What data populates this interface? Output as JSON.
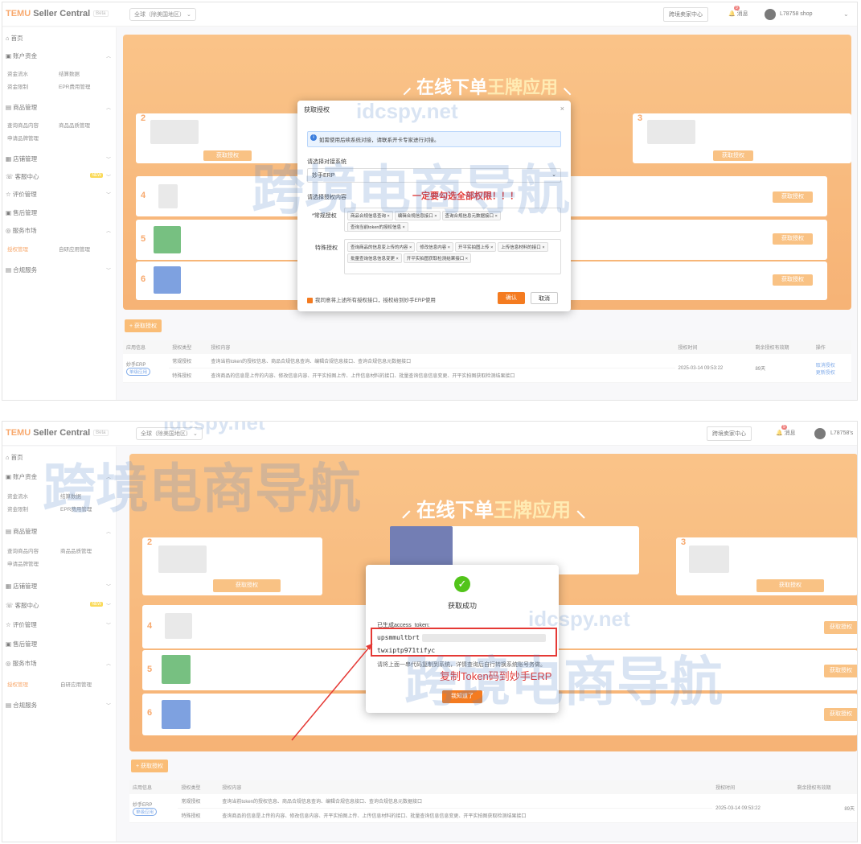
{
  "header": {
    "logo_temu": "TEMU",
    "logo_rest": "Seller Central",
    "beta": "Beta",
    "region": "全球（除美国地区）",
    "hub": "跨境卖家中心",
    "messages": "消息",
    "message_count": "9",
    "shop_1": "L78758 shop",
    "shop_2": "L78758's"
  },
  "sidebar": {
    "home": "首页",
    "account": "账户资金",
    "account_items": [
      "资金流水",
      "结算数据",
      "资金限制",
      "EPR费用管理"
    ],
    "products": "商品管理",
    "products_items": [
      "查询商品内容",
      "商品品质管理",
      "申请品牌管理"
    ],
    "stores": "店铺管理",
    "customer": "客服中心",
    "new_badge": "NEW",
    "reviews": "评价管理",
    "aftersale": "售后管理",
    "market": "服务市场",
    "market_items": [
      "授权管理",
      "自研应用管理"
    ],
    "compliance": "合规服务"
  },
  "banner": {
    "title_a": "在线下单",
    "title_b": "王牌应用",
    "get_button": "获取授权"
  },
  "add_button": "+ 获取授权",
  "table": {
    "headers": [
      "应用信息",
      "授权类型",
      "授权内容",
      "授权时间",
      "剩余授权有效期",
      "操作"
    ],
    "app_name": "妙手ERP",
    "app_badge": "单级应用",
    "rows": [
      {
        "type": "常规授权",
        "content": "查询当前token的授权信息、商品合规信息查询、编辑合规信息接口、查询合规信息元数据接口"
      },
      {
        "type": "特殊授权",
        "content": "查询商品的信息是上传的内容、修改信息内容、开平实拍图上传、上传信息材料的接口、批量查询信息信息变更、开平实拍图获取检测结果接口"
      }
    ],
    "time": "2025-03-14 09:53:22",
    "time_2": "2025-03-14 09:53:22",
    "days": "89天",
    "action_1": "取消授权",
    "action_2": "更新授权"
  },
  "auth_dialog": {
    "title": "获取授权",
    "info": "如需使用后续系统对接，请联系开卡专家进行对接。",
    "select_label": "请选择对接系统",
    "select_value": "妙手ERP",
    "content_label": "请选择授权内容",
    "normal_label": "*常规授权",
    "normal_tags": [
      "商品合规信息查询",
      "编辑合规信息接口",
      "查询合规信息元数据接口",
      "查询当前token的授权信息"
    ],
    "special_label": "特殊授权",
    "special_tags": [
      "查询商品的信息变上传的内容",
      "修改信息内容",
      "开平实拍图上传",
      "上传信息材料的接口",
      "批量查询信息信息变更",
      "开平实拍图获取检测结果接口"
    ],
    "annotation": "一定要勾选全部权限！！！",
    "agree": "我同意将上述所有授权接口，授权给到妙手ERP使用",
    "confirm": "确认",
    "cancel": "取消"
  },
  "success_dialog": {
    "title": "获取成功",
    "token_label": "已生成access_token:",
    "token_line1": "upsmmultbrt",
    "token_line2": "twxiptp971tifyc",
    "note": "请将上面一串代码复制到系统，详情查询后自行转换系统账号务做。",
    "ok": "我知道了",
    "annotation": "复制Token码到妙手ERP"
  },
  "watermark": {
    "site": "idcspy.net",
    "cn": "跨境电商导航"
  }
}
